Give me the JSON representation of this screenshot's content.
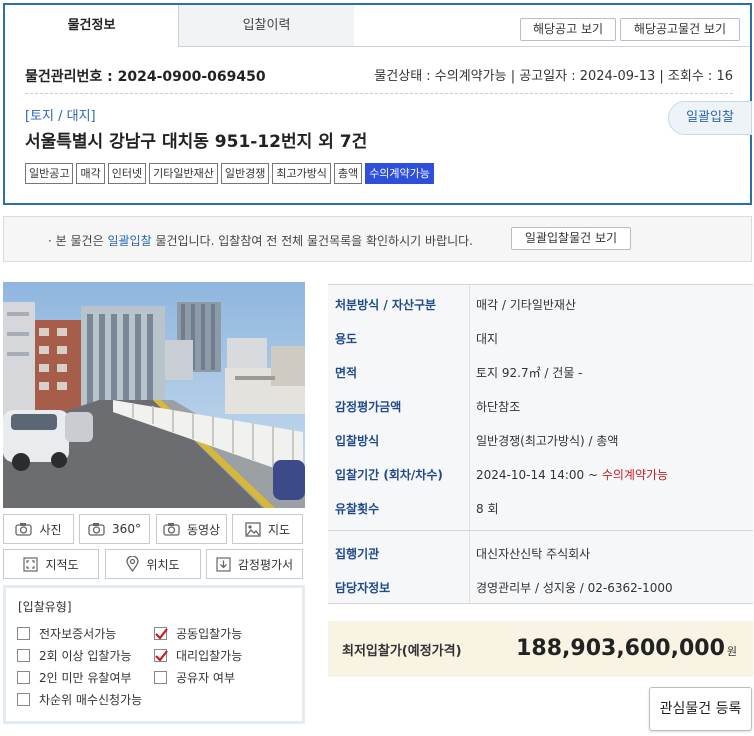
{
  "tabs": {
    "info": "물건정보",
    "history": "입찰이력"
  },
  "top_buttons": {
    "notice": "해당공고 보기",
    "notice_items": "해당공고물건 보기"
  },
  "summary": {
    "mgmt_no": "물건관리번호 : 2024-0900-069450",
    "status": "물건상태 : 수의계약가능",
    "notice_date": "공고일자 : 2024-09-13",
    "views": "조회수 : 16",
    "category": "[토지 / 대지]",
    "address": "서울특별시 강남구 대치동 951-12번지 외 7건",
    "bulk_badge": "일괄입찰"
  },
  "tags": [
    {
      "label": "일반공고",
      "active": false
    },
    {
      "label": "매각",
      "active": false
    },
    {
      "label": "인터넷",
      "active": false
    },
    {
      "label": "기타일반재산",
      "active": false
    },
    {
      "label": "일반경쟁",
      "active": false
    },
    {
      "label": "최고가방식",
      "active": false
    },
    {
      "label": "총액",
      "active": false
    },
    {
      "label": "수의계약가능",
      "active": true
    }
  ],
  "notice": {
    "bullet": "·",
    "prefix": "본 물건은 ",
    "highlight": "일괄입찰",
    "suffix": " 물건입니다. 입찰참여 전 전체 물건목록을 확인하시기 바랍니다.",
    "button": "일괄입찰물건 보기"
  },
  "media_buttons": {
    "photo": "사진",
    "view360": "360°",
    "video": "동영상",
    "map": "지도",
    "cadastral": "지적도",
    "location": "위치도",
    "appraisal": "감정평가서"
  },
  "bid_type": {
    "title": "[입찰유형]",
    "options": [
      {
        "label": "전자보증서가능",
        "checked": false
      },
      {
        "label": "공동입찰가능",
        "checked": true
      },
      {
        "label": "2회 이상 입찰가능",
        "checked": false
      },
      {
        "label": "대리입찰가능",
        "checked": true
      },
      {
        "label": "2인 미만 유찰여부",
        "checked": false
      },
      {
        "label": "공유자 여부",
        "checked": false
      },
      {
        "label": "차순위 매수신청가능",
        "checked": false
      }
    ]
  },
  "info": {
    "disposal": {
      "label": "처분방식 / 자산구분",
      "value": "매각 / 기타일반재산"
    },
    "usage": {
      "label": "용도",
      "value": "대지"
    },
    "area": {
      "label": "면적",
      "value": "토지 92.7㎡ / 건물 -"
    },
    "appraisal": {
      "label": "감정평가금액",
      "value": "하단참조"
    },
    "bid_method": {
      "label": "입찰방식",
      "value": "일반경쟁(최고가방식) / 총액"
    },
    "bid_period": {
      "label": "입찰기간 (회차/차수)",
      "value": "2024-10-14 14:00 ~ ",
      "value_red": "수의계약가능"
    },
    "fail_count": {
      "label": "유찰횟수",
      "value": "8 회"
    },
    "executor": {
      "label": "집행기관",
      "value": "대신자산신탁 주식회사"
    },
    "contact": {
      "label": "담당자정보",
      "value": "경영관리부 / 성지웅 / 02-6362-1000"
    }
  },
  "price": {
    "label": "최저입찰가(예정가격)",
    "value": "188,903,600,000",
    "unit": "원"
  },
  "favorite_button": "관심물건 등록",
  "colors": {
    "accent_blue": "#2d6fa8",
    "tag_active": "#2d4fdc",
    "label_blue": "#1f4a8a",
    "red": "#c81e1e",
    "price_bg": "#f8f3e3"
  }
}
